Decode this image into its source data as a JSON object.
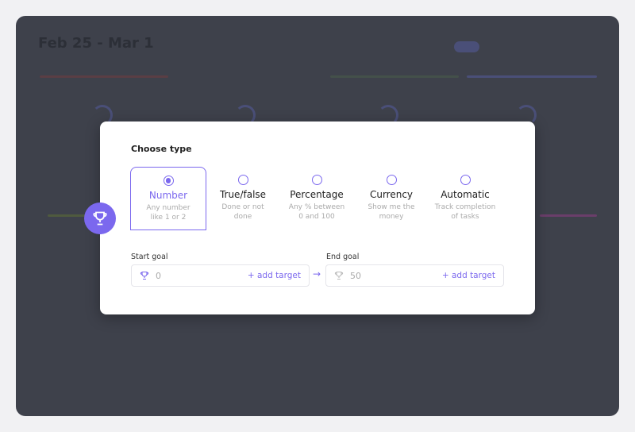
{
  "background": {
    "date_range": "Feb 25 - Mar 1"
  },
  "modal": {
    "heading": "Choose type",
    "options": [
      {
        "label": "Number",
        "desc1": "Any number",
        "desc2": "like 1 or 2",
        "selected": true
      },
      {
        "label": "True/false",
        "desc1": "Done or not",
        "desc2": "done",
        "selected": false
      },
      {
        "label": "Percentage",
        "desc1": "Any % between",
        "desc2": "0 and 100",
        "selected": false
      },
      {
        "label": "Currency",
        "desc1": "Show me the",
        "desc2": "money",
        "selected": false
      },
      {
        "label": "Automatic",
        "desc1": "Track completion",
        "desc2": "of tasks",
        "selected": false
      }
    ],
    "start_goal": {
      "label": "Start goal",
      "value": "0",
      "add": "+ add target"
    },
    "end_goal": {
      "label": "End goal",
      "value": "50",
      "add": "+ add target"
    },
    "accent": "#7b68ee"
  }
}
